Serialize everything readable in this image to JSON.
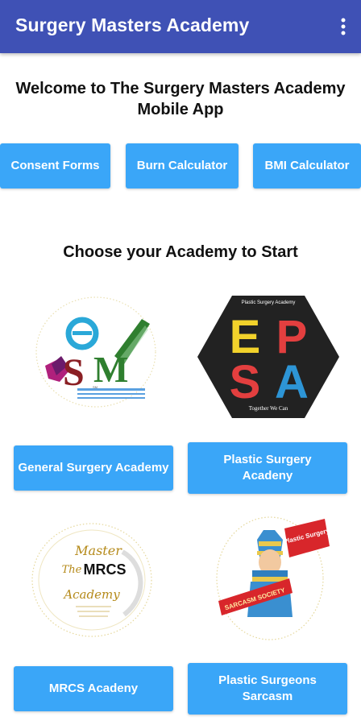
{
  "appbar": {
    "title": "Surgery Masters Academy",
    "menu_icon": "more-vert-icon"
  },
  "welcome": {
    "line1": "Welcome to The Surgery Masters Academy",
    "line2": "Mobile App"
  },
  "tools": [
    {
      "label": "Consent Forms"
    },
    {
      "label": "Burn Calculator"
    },
    {
      "label": "BMI Calculator"
    }
  ],
  "choose_heading": "Choose your Academy to Start",
  "academies": [
    {
      "label": "General Surgery Academy",
      "logo_icon": "sm-logo",
      "logo_text": "SM"
    },
    {
      "label_line1": "Plastic Surgery",
      "label_line2": "Acadeny",
      "logo_icon": "epsa-hexagon-logo",
      "logo_letters": [
        "E",
        "P",
        "S",
        "A"
      ],
      "logo_top": "Plastic Surgery Academy",
      "logo_bottom": "Together We Can"
    },
    {
      "label": "MRCS Acadeny",
      "logo_icon": "mrcs-logo",
      "logo_lines": [
        "Master",
        "The",
        "MRCS",
        "Academy"
      ]
    },
    {
      "label_line1": "Plastic Surgeons",
      "label_line2": "Sarcasm",
      "logo_icon": "sarcasm-logo",
      "logo_banner": "Plastic Surgery",
      "logo_ribbon": "SARCASM SOCIETY"
    }
  ],
  "colors": {
    "appbar": "#3f51b5",
    "button": "#3aa6f8"
  }
}
